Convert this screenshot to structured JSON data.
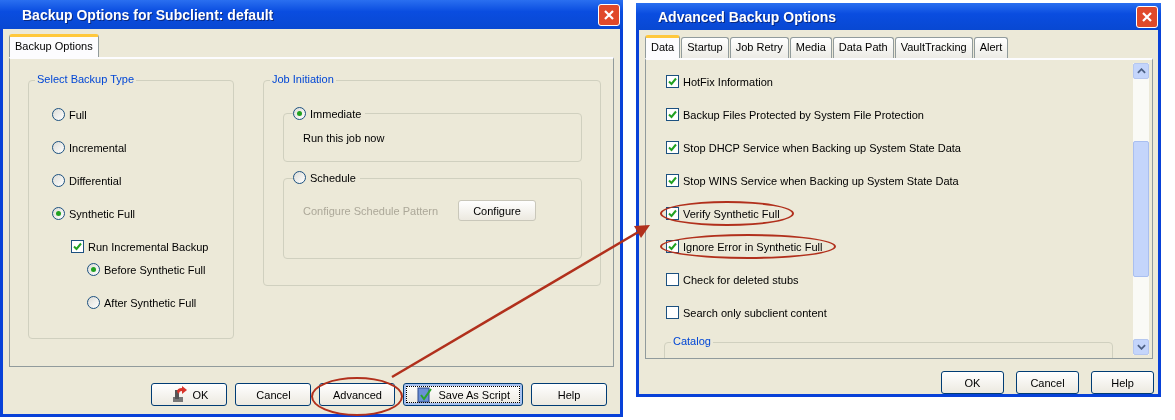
{
  "left_window": {
    "title": "Backup Options for Subclient: default",
    "tabs": [
      {
        "label": "Backup Options",
        "selected": true
      }
    ],
    "backup_type": {
      "title": "Select Backup Type",
      "options": [
        {
          "label": "Full",
          "selected": false
        },
        {
          "label": "Incremental",
          "selected": false
        },
        {
          "label": "Differential",
          "selected": false
        },
        {
          "label": "Synthetic Full",
          "selected": true
        }
      ],
      "run_incremental": {
        "label": "Run Incremental Backup",
        "checked": true
      },
      "timing": [
        {
          "label": "Before Synthetic Full",
          "selected": true
        },
        {
          "label": "After Synthetic Full",
          "selected": false
        }
      ]
    },
    "job_initiation": {
      "title": "Job Initiation",
      "immediate": {
        "label": "Immediate",
        "selected": true,
        "description": "Run this job now"
      },
      "schedule": {
        "label": "Schedule",
        "selected": false,
        "pattern_label": "Configure Schedule Pattern",
        "button": "Configure",
        "disabled": true
      }
    },
    "buttons": [
      {
        "label": "OK",
        "kind": "ok",
        "focused": false,
        "highlighted": false
      },
      {
        "label": "Cancel",
        "kind": "plain",
        "focused": false,
        "highlighted": false
      },
      {
        "label": "Advanced",
        "kind": "plain",
        "focused": false,
        "highlighted": true
      },
      {
        "label": "Save As Script",
        "kind": "script",
        "focused": true,
        "highlighted": false
      },
      {
        "label": "Help",
        "kind": "plain",
        "focused": false,
        "highlighted": false
      }
    ]
  },
  "right_window": {
    "title": "Advanced Backup Options",
    "tabs": [
      {
        "label": "Data",
        "selected": true
      },
      {
        "label": "Startup",
        "selected": false
      },
      {
        "label": "Job Retry",
        "selected": false
      },
      {
        "label": "Media",
        "selected": false
      },
      {
        "label": "Data Path",
        "selected": false
      },
      {
        "label": "VaultTracking",
        "selected": false
      },
      {
        "label": "Alert",
        "selected": false
      }
    ],
    "options": [
      {
        "label": "HotFix Information",
        "checked": true,
        "highlighted": false
      },
      {
        "label": "Backup Files Protected by  System File Protection",
        "checked": true,
        "highlighted": false
      },
      {
        "label": "Stop DHCP Service when Backing up System State Data",
        "checked": true,
        "highlighted": false
      },
      {
        "label": "Stop WINS Service when Backing up System State Data",
        "checked": true,
        "highlighted": false
      },
      {
        "label": "Verify Synthetic Full",
        "checked": true,
        "highlighted": true
      },
      {
        "label": "Ignore Error in Synthetic Full",
        "checked": true,
        "highlighted": true
      },
      {
        "label": "Check for deleted stubs",
        "checked": false,
        "highlighted": false
      },
      {
        "label": "Search only subclient content",
        "checked": false,
        "highlighted": false
      }
    ],
    "catalog_group": {
      "title": "Catalog"
    },
    "buttons": [
      {
        "label": "OK"
      },
      {
        "label": "Cancel"
      },
      {
        "label": "Help"
      }
    ]
  }
}
